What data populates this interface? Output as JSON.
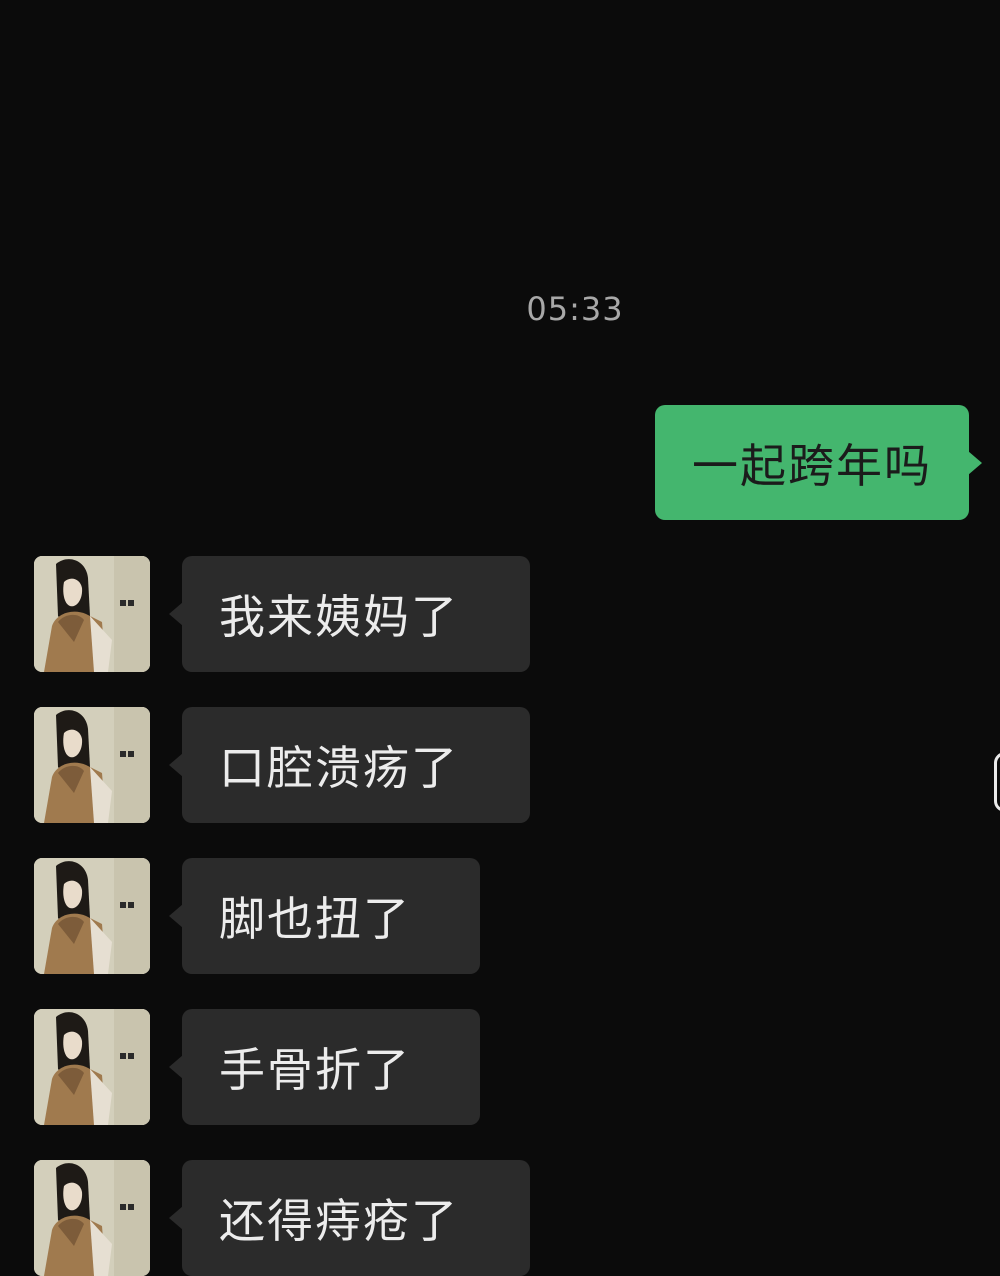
{
  "conversation": {
    "timestamp": "05:33",
    "sent_message": "一起跨年吗",
    "received_messages": [
      {
        "text": "我来姨妈了"
      },
      {
        "text": "口腔溃疡了"
      },
      {
        "text": "脚也扭了"
      },
      {
        "text": "手骨折了"
      },
      {
        "text": "还得痔疮了"
      }
    ]
  },
  "colors": {
    "background": "#0b0b0b",
    "sent_bubble": "#44b66e",
    "received_bubble": "#2b2b2b",
    "timestamp_text": "#a8a8a8"
  }
}
